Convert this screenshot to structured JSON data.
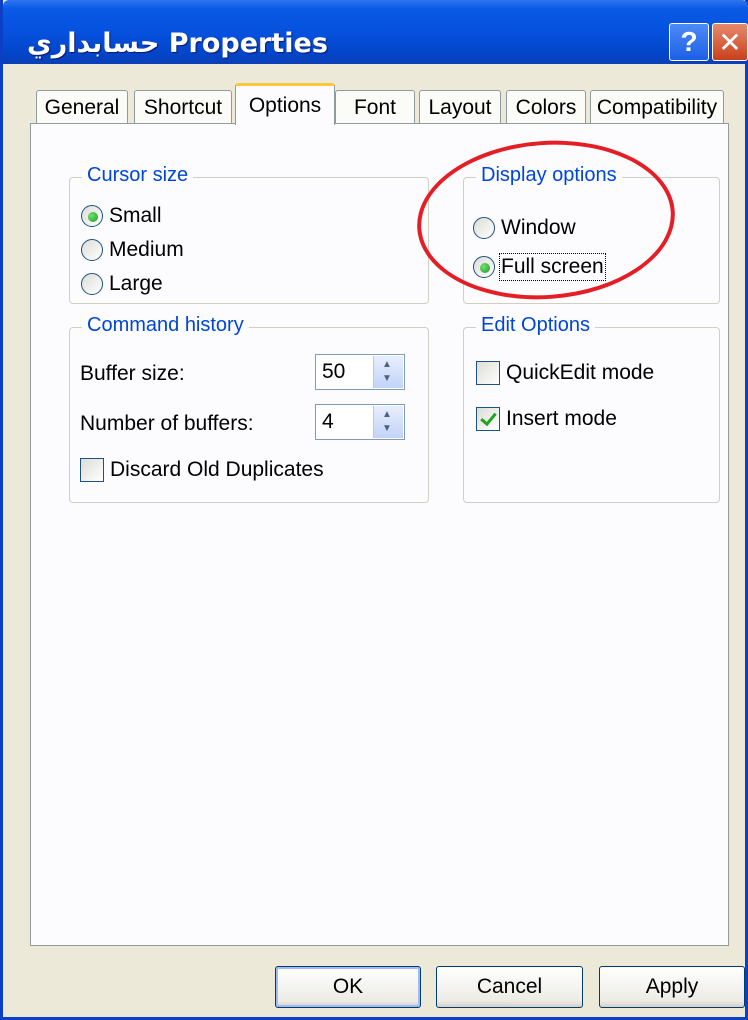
{
  "window": {
    "title": "حسابداري Properties",
    "help_label": "?",
    "close_label": "✕"
  },
  "tabs": [
    {
      "label": "General",
      "active": false
    },
    {
      "label": "Shortcut",
      "active": false
    },
    {
      "label": "Options",
      "active": true
    },
    {
      "label": "Font",
      "active": false
    },
    {
      "label": "Layout",
      "active": false
    },
    {
      "label": "Colors",
      "active": false
    },
    {
      "label": "Compatibility",
      "active": false
    }
  ],
  "cursor_size": {
    "legend": "Cursor size",
    "options": [
      {
        "label": "Small",
        "selected": true
      },
      {
        "label": "Medium",
        "selected": false
      },
      {
        "label": "Large",
        "selected": false
      }
    ]
  },
  "display_options": {
    "legend": "Display options",
    "options": [
      {
        "label": "Window",
        "selected": false
      },
      {
        "label": "Full screen",
        "selected": true
      }
    ]
  },
  "command_history": {
    "legend": "Command history",
    "buffer_size_label": "Buffer size:",
    "buffer_size_value": "50",
    "num_buffers_label": "Number of buffers:",
    "num_buffers_value": "4",
    "discard_label": "Discard Old Duplicates",
    "discard_checked": false
  },
  "edit_options": {
    "legend": "Edit Options",
    "quickedit_label": "QuickEdit mode",
    "quickedit_checked": false,
    "insert_label": "Insert mode",
    "insert_checked": true
  },
  "buttons": {
    "ok": "OK",
    "cancel": "Cancel",
    "apply": "Apply"
  },
  "colors": {
    "title_bar": "#0550dc",
    "dialog_bg": "#ece9d8",
    "legend_text": "#0046d5",
    "annotation_circle": "#e51d24"
  }
}
